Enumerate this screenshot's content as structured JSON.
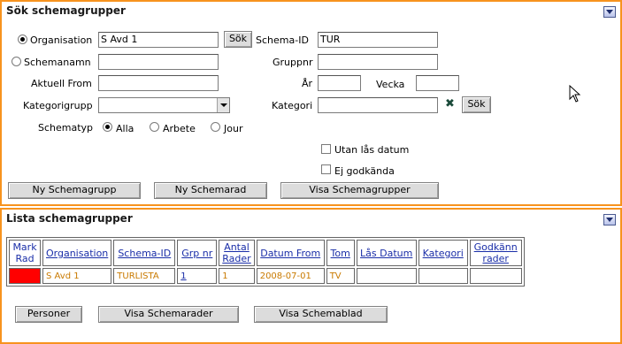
{
  "search": {
    "title": "Sök schemagrupper",
    "organisation_label": "Organisation",
    "organisation_value": "S Avd 1",
    "sok_button": "Sök",
    "schema_id_label": "Schema-ID",
    "schema_id_value": "TUR",
    "schemanamn_label": "Schemanamn",
    "gruppnr_label": "Gruppnr",
    "aktuell_from_label": "Aktuell From",
    "ar_label": "År",
    "vecka_label": "Vecka",
    "kategorigrupp_label": "Kategorigrupp",
    "kategori_label": "Kategori",
    "kategori_sok_button": "Sök",
    "schematyp_label": "Schematyp",
    "schematyp_options": [
      "Alla",
      "Arbete",
      "Jour"
    ],
    "schematyp_selected": "Alla",
    "utan_las_label": "Utan lås datum",
    "ej_godkanda_label": "Ej godkända",
    "buttons": [
      "Ny Schemagrupp",
      "Ny Schemarad",
      "Visa Schemagrupper"
    ]
  },
  "list": {
    "title": "Lista schemagrupper",
    "columns": [
      "Mark Rad",
      "Organisation",
      "Schema-ID",
      "Grp nr",
      "Antal Rader",
      "Datum From",
      "Tom",
      "Lås Datum",
      "Kategori",
      "Godkänn rader"
    ],
    "rows": [
      {
        "organisation": "S Avd 1",
        "schema_id": "TURLISTA",
        "grp_nr": "1",
        "antal_rader": "1",
        "datum_from": "2008-07-01",
        "tom": "TV",
        "las_datum": "",
        "kategori": "",
        "godkann": ""
      }
    ],
    "buttons": [
      "Personer",
      "Visa Schemarader",
      "Visa Schemablad"
    ]
  },
  "colors": {
    "accent_border": "#f7931e",
    "marked_row": "#ff0000",
    "cell_text": "#c97a00",
    "link": "#1a2ea8"
  },
  "icons": {
    "collapse": "chevron-down-icon",
    "clear": "x-icon",
    "cursor": "mouse-pointer-icon"
  }
}
